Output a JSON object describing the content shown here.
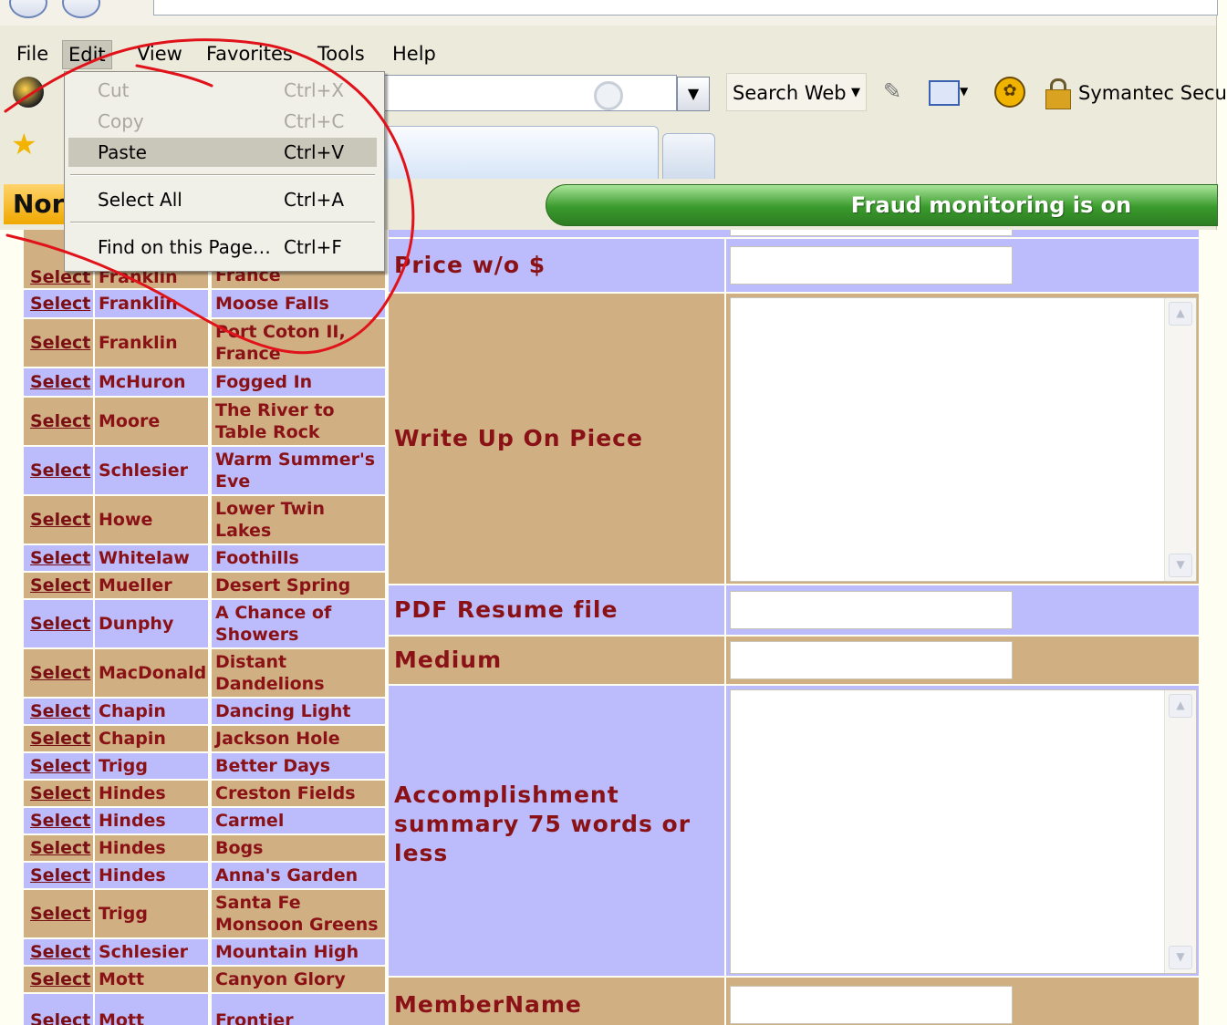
{
  "menu": {
    "items": [
      "File",
      "Edit",
      "View",
      "Favorites",
      "Tools",
      "Help"
    ],
    "active": "Edit"
  },
  "edit_menu": {
    "items": [
      {
        "label": "Cut",
        "shortcut": "Ctrl+X",
        "state": "disabled"
      },
      {
        "label": "Copy",
        "shortcut": "Ctrl+C",
        "state": "disabled"
      },
      {
        "label": "Paste",
        "shortcut": "Ctrl+V",
        "state": "highlighted"
      },
      {
        "label": "Select All",
        "shortcut": "Ctrl+A",
        "state": "enabled"
      },
      {
        "label": "Find on this Page…",
        "shortcut": "Ctrl+F",
        "state": "enabled"
      }
    ]
  },
  "toolbar": {
    "search_web_label": "Search Web",
    "symantec_label": "Symantec Secur"
  },
  "norton": {
    "logo_text": "Nor",
    "fraud_status": "Fraud monitoring is on"
  },
  "colors": {
    "row_blue": "#bcbcfc",
    "row_tan": "#d0b083",
    "text_maroon": "#8a1217",
    "fraud_green": "#3a9a2c",
    "annotation_red": "#e0121a"
  },
  "left_table": {
    "link_text": "Select",
    "rows": [
      {
        "artist": "Franklin",
        "title": "Port Coton II, France"
      },
      {
        "artist": "Franklin",
        "title": "Moose Falls"
      },
      {
        "artist": "Franklin",
        "title": "Port Coton II, France"
      },
      {
        "artist": "McHuron",
        "title": "Fogged In"
      },
      {
        "artist": "Moore",
        "title": "The River to Table Rock"
      },
      {
        "artist": "Schlesier",
        "title": "Warm Summer's Eve"
      },
      {
        "artist": "Howe",
        "title": "Lower Twin Lakes"
      },
      {
        "artist": "Whitelaw",
        "title": "Foothills"
      },
      {
        "artist": "Mueller",
        "title": "Desert Spring"
      },
      {
        "artist": "Dunphy",
        "title": "A Chance of Showers"
      },
      {
        "artist": "MacDonald",
        "title": "Distant Dandelions"
      },
      {
        "artist": "Chapin",
        "title": "Dancing Light"
      },
      {
        "artist": "Chapin",
        "title": "Jackson Hole"
      },
      {
        "artist": "Trigg",
        "title": "Better Days"
      },
      {
        "artist": "Hindes",
        "title": "Creston Fields"
      },
      {
        "artist": "Hindes",
        "title": "Carmel"
      },
      {
        "artist": "Hindes",
        "title": "Bogs"
      },
      {
        "artist": "Hindes",
        "title": "Anna's Garden"
      },
      {
        "artist": "Trigg",
        "title": "Santa Fe Monsoon Greens"
      },
      {
        "artist": "Schlesier",
        "title": "Mountain High"
      },
      {
        "artist": "Mott",
        "title": "Canyon Glory"
      },
      {
        "artist": "Mott",
        "title": "Frontier"
      }
    ]
  },
  "form": {
    "fields": [
      {
        "label": "Price w/o $",
        "type": "text",
        "value": ""
      },
      {
        "label": "Write Up On Piece",
        "type": "textarea",
        "value": ""
      },
      {
        "label": "PDF Resume file",
        "type": "text",
        "value": ""
      },
      {
        "label": "Medium",
        "type": "text",
        "value": ""
      },
      {
        "label": "Accomplishment summary 75 words or less",
        "type": "textarea",
        "value": ""
      },
      {
        "label": "MemberName",
        "type": "text",
        "value": ""
      }
    ]
  }
}
